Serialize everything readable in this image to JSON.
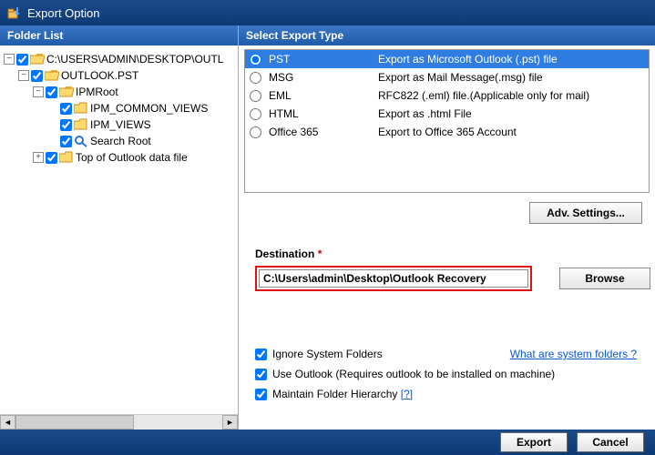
{
  "title": "Export Option",
  "left_header": "Folder List",
  "right_header": "Select Export Type",
  "tree": {
    "n0": "C:\\USERS\\ADMIN\\DESKTOP\\OUTL",
    "n1": "OUTLOOK.PST",
    "n2": "IPMRoot",
    "n3": "IPM_COMMON_VIEWS",
    "n4": "IPM_VIEWS",
    "n5": "Search Root",
    "n6": "Top of Outlook data file"
  },
  "exports": [
    {
      "radio_checked": true,
      "label": "PST",
      "desc": "Export as Microsoft Outlook (.pst) file"
    },
    {
      "radio_checked": false,
      "label": "MSG",
      "desc": "Export as Mail Message(.msg) file"
    },
    {
      "radio_checked": false,
      "label": "EML",
      "desc": "RFC822 (.eml) file.(Applicable only for mail)"
    },
    {
      "radio_checked": false,
      "label": "HTML",
      "desc": "Export as .html File"
    },
    {
      "radio_checked": false,
      "label": "Office 365",
      "desc": "Export to Office 365 Account"
    }
  ],
  "adv_label": "Adv. Settings...",
  "dest_label": "Destination",
  "dest_value": "C:\\Users\\admin\\Desktop\\Outlook Recovery",
  "browse_label": "Browse",
  "opt_ignore": "Ignore System Folders",
  "sys_link": "What are system folders ?",
  "opt_outlook": "Use Outlook (Requires outlook to be installed on machine)",
  "opt_hierarchy": "Maintain Folder Hierarchy",
  "hier_help": "[?]",
  "export_btn": "Export",
  "cancel_btn": "Cancel"
}
